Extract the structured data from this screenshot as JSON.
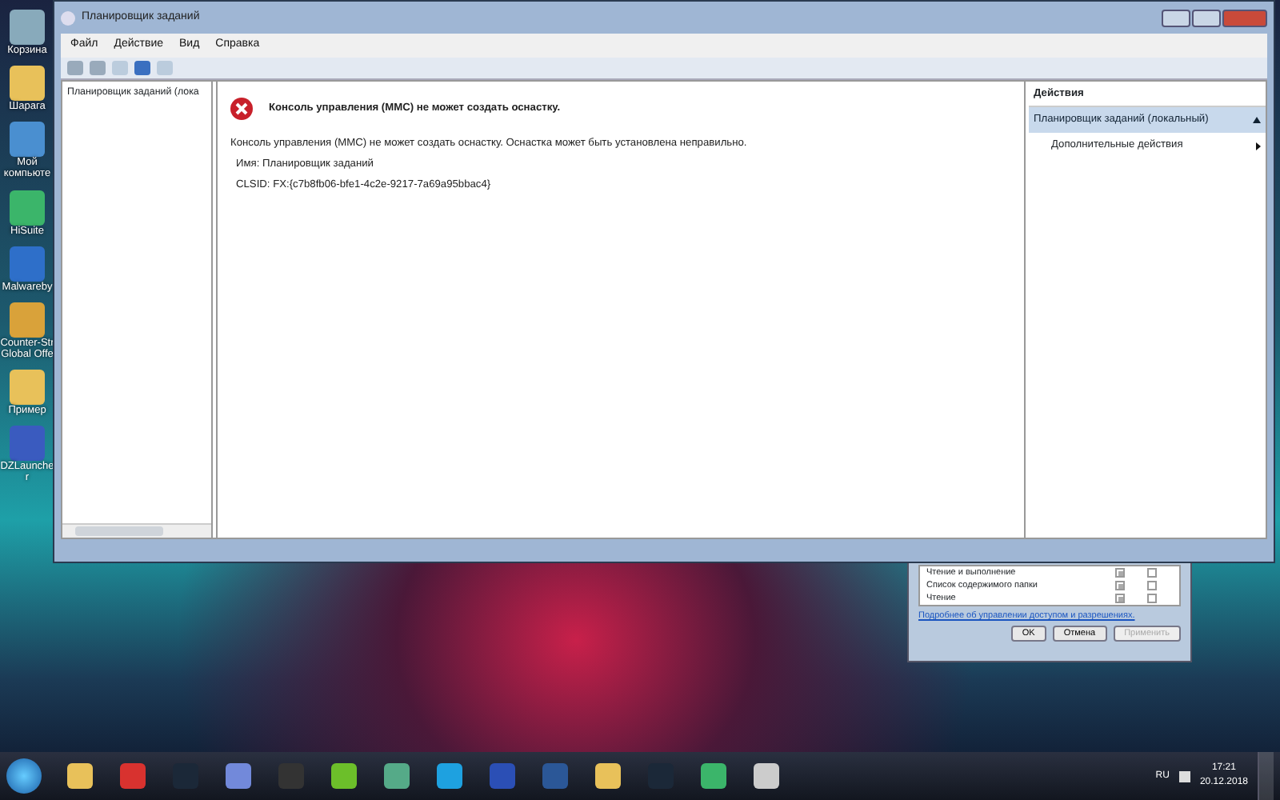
{
  "desktop_icons": [
    {
      "label": "Корзина"
    },
    {
      "label": "Шарага"
    },
    {
      "label": "Мой компьюте"
    },
    {
      "label": "HiSuite"
    },
    {
      "label": "Malwareby"
    },
    {
      "label": "Counter-Str Global Offe"
    },
    {
      "label": "Пример"
    },
    {
      "label": "DZLauncher"
    }
  ],
  "window": {
    "title": "Планировщик заданий",
    "menu": [
      "Файл",
      "Действие",
      "Вид",
      "Справка"
    ],
    "tree": [
      {
        "label": "Планировщик заданий (лока",
        "selected": false
      }
    ],
    "error": {
      "heading": "Консоль управления (MMC) не может создать оснастку.",
      "message": "Консоль управления (MMC) не может создать оснастку. Оснастка может быть установлена неправильно.",
      "details": [
        "Имя: Планировщик заданий",
        "CLSID: FX:{c7b8fb06-bfe1-4c2e-9217-7a69a95bbac4}"
      ]
    },
    "actions": {
      "title": "Действия",
      "groups": [
        {
          "label": "Планировщик заданий (локальный)",
          "expanded": true,
          "items": [
            {
              "label": "Дополнительные действия"
            }
          ]
        }
      ]
    }
  },
  "permissions_dialog": {
    "rows": [
      {
        "label": "Чтение и выполнение",
        "allow": true,
        "deny": false
      },
      {
        "label": "Список содержимого папки",
        "allow": true,
        "deny": false
      },
      {
        "label": "Чтение",
        "allow": true,
        "deny": false
      }
    ],
    "link": "Подробнее об управлении доступом и разрешениях.",
    "buttons": [
      {
        "label": "OK",
        "disabled": false
      },
      {
        "label": "Отмена",
        "disabled": false
      },
      {
        "label": "Применить",
        "disabled": true
      }
    ]
  },
  "taskbar": {
    "language": "RU",
    "time": "17:21",
    "date": "20.12.2018"
  }
}
